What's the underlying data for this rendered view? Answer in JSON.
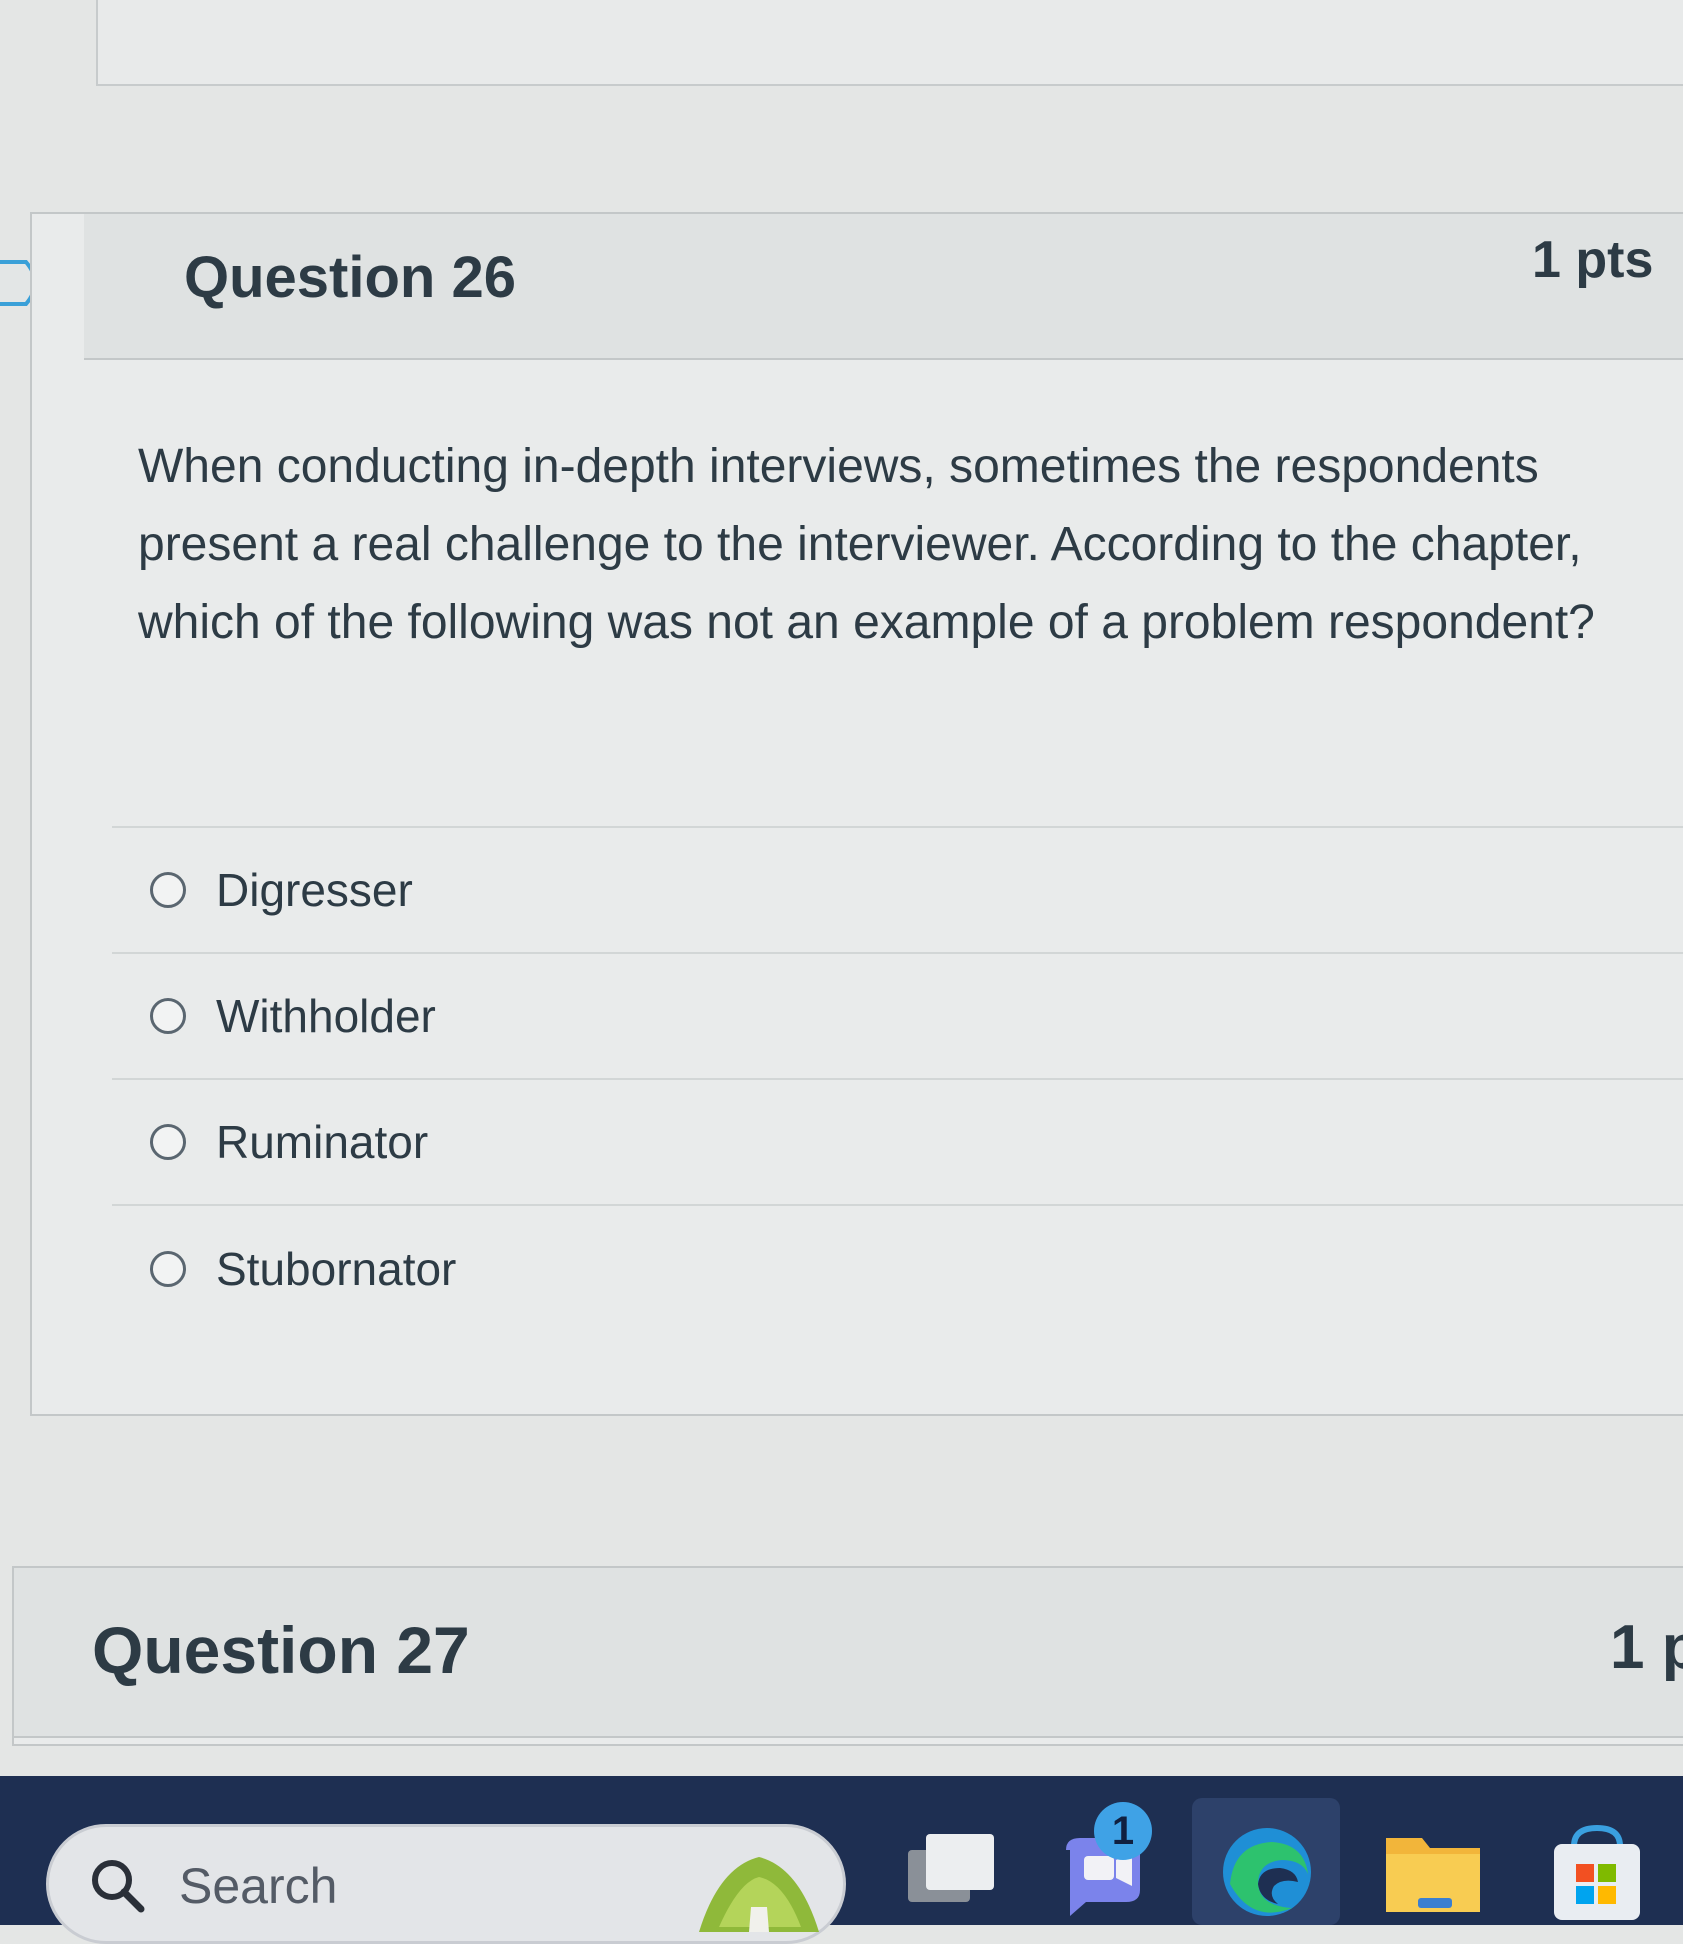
{
  "quiz": {
    "question_26": {
      "title": "Question 26",
      "points": "1 pts",
      "text": "When conducting in-depth interviews, sometimes the respondents present a real challenge to the interviewer. According to the chapter, which of the following was not an example of a problem respondent?",
      "answers": [
        "Digresser",
        "Withholder",
        "Ruminator",
        "Stubornator"
      ]
    },
    "question_27": {
      "title": "Question 27",
      "points": "1 p"
    }
  },
  "taskbar": {
    "search_placeholder": "Search",
    "teams_badge": "1",
    "icons": [
      "search-icon",
      "task-view-icon",
      "teams-chat-icon",
      "edge-icon",
      "file-explorer-icon",
      "microsoft-store-icon"
    ]
  },
  "colors": {
    "text": "#2d3b45",
    "card_border": "#c3c7c8",
    "taskbar": "#1e2f52"
  }
}
